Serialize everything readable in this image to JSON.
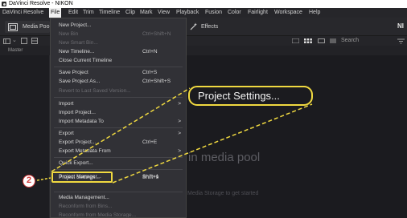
{
  "window": {
    "title": "DaVinci Resolve - NIKON"
  },
  "menubar": {
    "items": [
      "DaVinci Resolve",
      "File",
      "Edit",
      "Trim",
      "Timeline",
      "Clip",
      "Mark",
      "View",
      "Playback",
      "Fusion",
      "Color",
      "Fairlight",
      "Workspace",
      "Help"
    ]
  },
  "toolbar": {
    "media_pool_label": "Media Poo",
    "effects_label": "Effects",
    "right_label": "NI"
  },
  "subbar": {
    "search_placeholder": "Search"
  },
  "path": {
    "label": "Master"
  },
  "file_menu": {
    "items": [
      {
        "label": "New Project...",
        "shortcut": "",
        "disabled": false,
        "submenu": false
      },
      {
        "label": "New Bin",
        "shortcut": "Ctrl+Shift+N",
        "disabled": true,
        "submenu": false
      },
      {
        "label": "New Smart Bin...",
        "shortcut": "",
        "disabled": true,
        "submenu": false
      },
      {
        "label": "New Timeline...",
        "shortcut": "Ctrl+N",
        "disabled": false,
        "submenu": false
      },
      {
        "label": "Close Current Timeline",
        "shortcut": "",
        "disabled": false,
        "submenu": false
      },
      {
        "label": "Save Project",
        "shortcut": "Ctrl+S",
        "disabled": false,
        "submenu": false
      },
      {
        "label": "Save Project As...",
        "shortcut": "Ctrl+Shift+S",
        "disabled": false,
        "submenu": false
      },
      {
        "label": "Revert to Last Saved Version...",
        "shortcut": "",
        "disabled": true,
        "submenu": false
      },
      {
        "label": "Import",
        "shortcut": "",
        "disabled": false,
        "submenu": true
      },
      {
        "label": "Import Project...",
        "shortcut": "",
        "disabled": false,
        "submenu": false
      },
      {
        "label": "Import Metadata To",
        "shortcut": "",
        "disabled": false,
        "submenu": true
      },
      {
        "label": "Export",
        "shortcut": "",
        "disabled": false,
        "submenu": true
      },
      {
        "label": "Export Project...",
        "shortcut": "Ctrl+E",
        "disabled": false,
        "submenu": false
      },
      {
        "label": "Export Metadata From",
        "shortcut": "",
        "disabled": false,
        "submenu": true
      },
      {
        "label": "Quick Export...",
        "shortcut": "",
        "disabled": false,
        "submenu": false
      },
      {
        "label": "Project Manager...",
        "shortcut": "Shift+1",
        "disabled": false,
        "submenu": false
      },
      {
        "label": "Project Settings...",
        "shortcut": "Shift+9",
        "disabled": false,
        "submenu": false
      },
      {
        "label": "Media Management...",
        "shortcut": "",
        "disabled": false,
        "submenu": false
      },
      {
        "label": "Reconform from Bins...",
        "shortcut": "",
        "disabled": true,
        "submenu": false
      },
      {
        "label": "Reconform from Media Storage...",
        "shortcut": "",
        "disabled": true,
        "submenu": false
      }
    ]
  },
  "media_pool": {
    "empty_text": "in media pool",
    "storage_hint": "Media Storage to get started"
  },
  "annotation": {
    "callout_text": "Project Settings...",
    "step_number": "2",
    "color": "#f0d940",
    "badge_color": "#d23a3a"
  }
}
